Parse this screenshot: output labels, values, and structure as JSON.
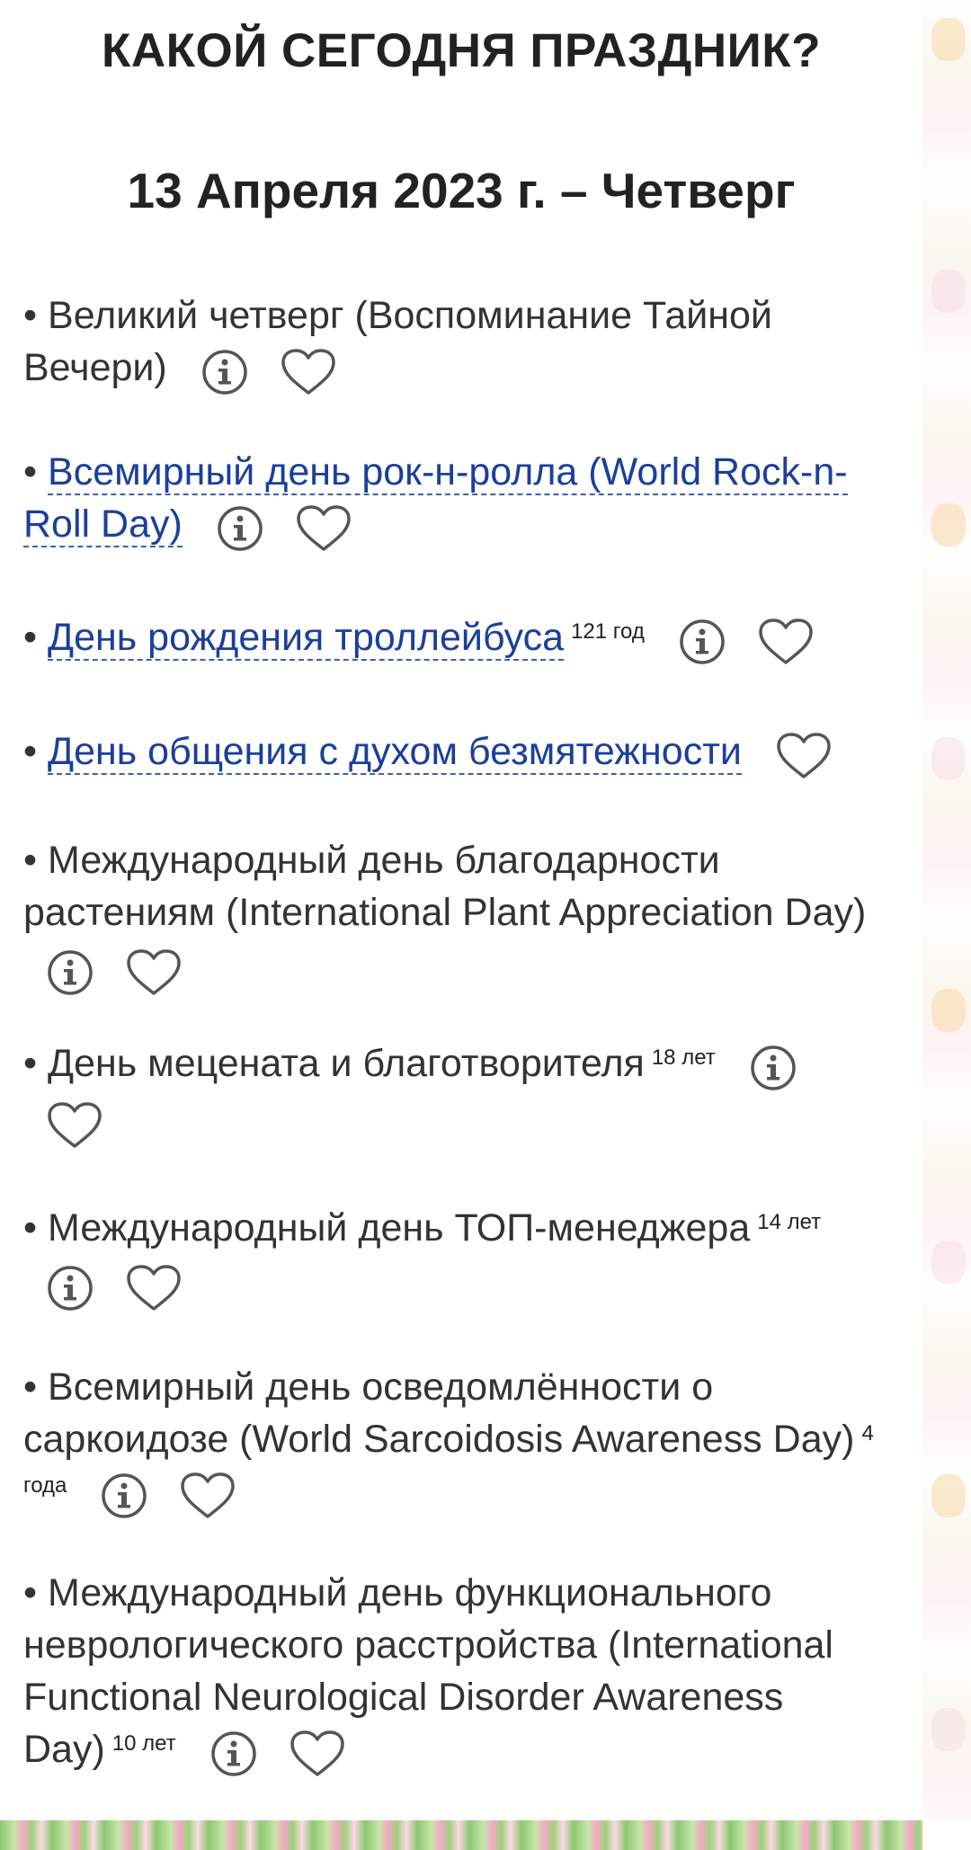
{
  "header": {
    "site_title": "КАКОЙ СЕГОДНЯ ПРАЗДНИК?",
    "date": "13 Апреля 2023 г. – Четверг"
  },
  "holidays": [
    {
      "text": "Великий четверг (Воспоминание Тайной Вечери)",
      "is_link": false,
      "age": "",
      "has_info": true,
      "has_favorite": true
    },
    {
      "text": "Всемирный день рок-н-ролла (World Rock-n-Roll Day)",
      "is_link": true,
      "age": "",
      "has_info": true,
      "has_favorite": true
    },
    {
      "text": "День рождения троллейбуса",
      "is_link": true,
      "age": "121 год",
      "has_info": true,
      "has_favorite": true
    },
    {
      "text": "День общения с духом безмятежности",
      "is_link": true,
      "age": "",
      "has_info": false,
      "has_favorite": true
    },
    {
      "text": "Международный день благодарности растениям (International Plant Appreciation Day)",
      "is_link": false,
      "age": "",
      "has_info": true,
      "has_favorite": true
    },
    {
      "text": "День мецената и благотворителя",
      "is_link": false,
      "age": "18 лет",
      "has_info": true,
      "has_favorite": true
    },
    {
      "text": "Международный день ТОП-менеджера",
      "is_link": false,
      "age": "14 лет",
      "has_info": true,
      "has_favorite": true
    },
    {
      "text": "Всемирный день осведомлённости о саркоидозе (World Sarcoidosis Awareness Day)",
      "is_link": false,
      "age": "4 года",
      "has_info": true,
      "has_favorite": true
    },
    {
      "text": "Международный день функционального неврологического расстройства (International Functional Neurological Disorder Awareness Day)",
      "is_link": false,
      "age": "10 лет",
      "has_info": true,
      "has_favorite": true
    }
  ],
  "bullet": "•",
  "icons": {
    "info": "info-circle-icon",
    "favorite": "heart-outline-icon"
  },
  "colors": {
    "link": "#1b3f9a",
    "text": "#333333",
    "heading": "#222222",
    "icon": "#555555"
  }
}
